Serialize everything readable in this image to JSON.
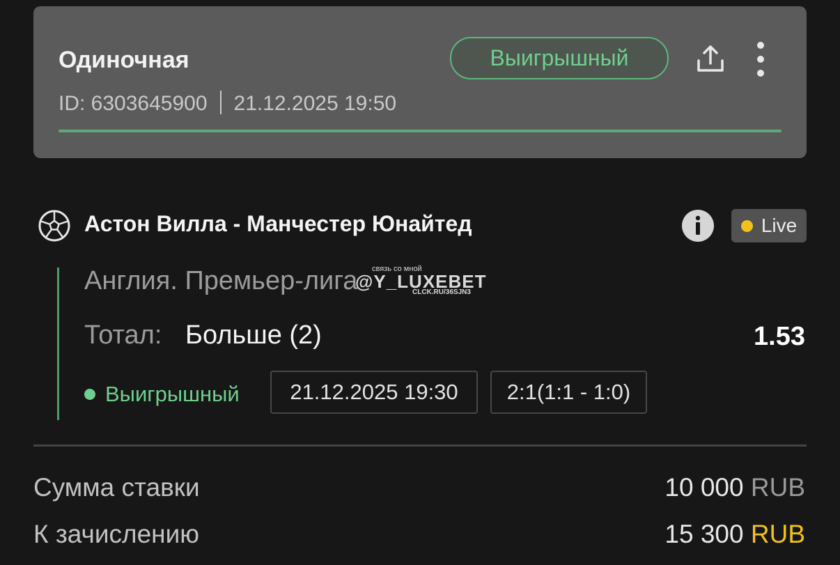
{
  "header": {
    "bet_type": "Одиночная",
    "id_text": "ID: 6303645900",
    "datetime": "21.12.2025 19:50",
    "status_label": "Выигрышный",
    "share_icon": "share-icon",
    "more_icon": "more-vertical-icon"
  },
  "event": {
    "sport_icon": "soccer-ball-icon",
    "title": "Астон Вилла - Манчестер Юнайтед",
    "info_icon": "info-icon",
    "live_label": "Live",
    "league": "Англия. Премьер-лига",
    "market_label": "Тотал:",
    "market_value": "Больше (2)",
    "odds": "1.53",
    "status": "Выигрышный",
    "event_datetime": "21.12.2025 19:30",
    "score": "2:1(1:1 - 1:0)"
  },
  "watermark": {
    "top": "связь со мной",
    "main": "@Y_LUXEBET",
    "bottom": "CLCK.RU/36SJN3"
  },
  "summary": {
    "stake_label": "Сумма ставки",
    "stake_amount": "10 000",
    "stake_currency": "RUB",
    "payout_label": "К зачислению",
    "payout_amount": "15 300",
    "payout_currency": "RUB"
  },
  "colors": {
    "background": "#171717",
    "card": "#5b5b5b",
    "win_green": "#6fcf8e",
    "live_yellow": "#f1c21b"
  }
}
